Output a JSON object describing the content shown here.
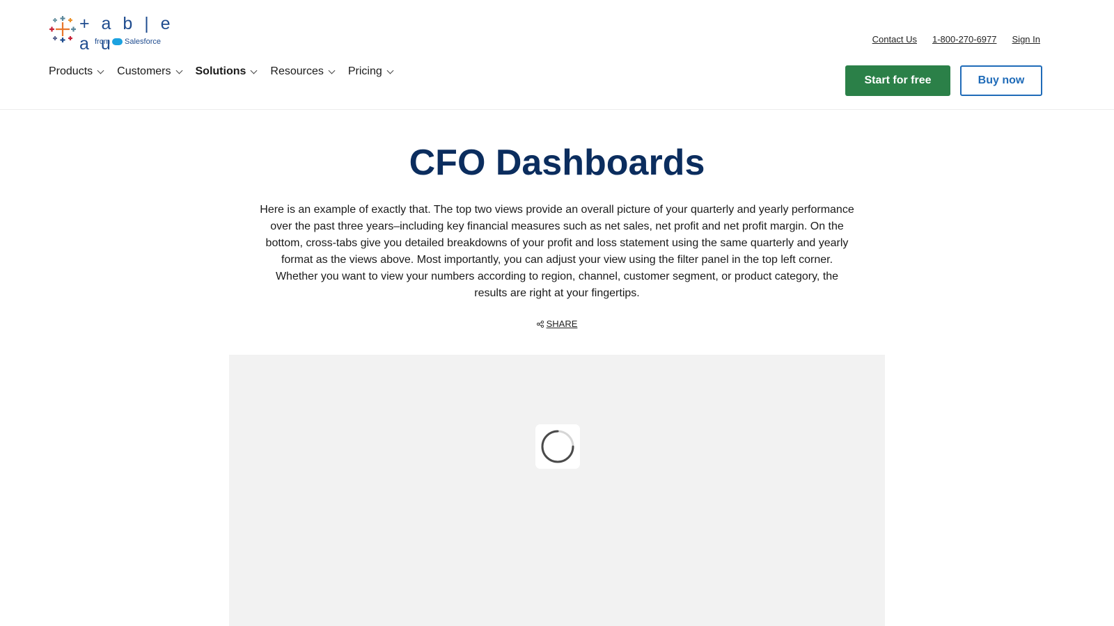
{
  "brand": {
    "wordmark": "+ a b | e a u",
    "sub_from": "from",
    "sub_company": "Salesforce"
  },
  "util_nav": {
    "contact": "Contact Us",
    "phone": "1-800-270-6977",
    "sign_in": "Sign In"
  },
  "main_nav": {
    "items": [
      {
        "label": "Products"
      },
      {
        "label": "Customers"
      },
      {
        "label": "Solutions"
      },
      {
        "label": "Resources"
      },
      {
        "label": "Pricing"
      }
    ],
    "active": "Solutions"
  },
  "cta": {
    "start_free": "Start for free",
    "buy_now": "Buy now"
  },
  "page": {
    "title": "CFO Dashboards",
    "description": "Here is an example of exactly that. The top two views provide an overall picture of your quarterly and yearly performance over the past three years–including key financial measures such as net sales, net profit and net profit margin. On the bottom, cross-tabs give you detailed breakdowns of your profit and loss statement using the same quarterly and yearly format as the views above. Most importantly, you can adjust your view using the filter panel in the top left corner. Whether you want to view your numbers according to region, channel, customer segment, or product category, the results are right at your fingertips.",
    "share_label": "SHARE"
  },
  "colors": {
    "title": "#0b2d5e",
    "primary_button": "#2b8048",
    "outline_button": "#1f6bb8",
    "viz_background": "#f2f2f2"
  },
  "icons": {
    "logo": "tableau-plus-mark",
    "share": "share-icon",
    "loader": "loading-spinner-icon",
    "chevron": "chevron-down-icon"
  }
}
